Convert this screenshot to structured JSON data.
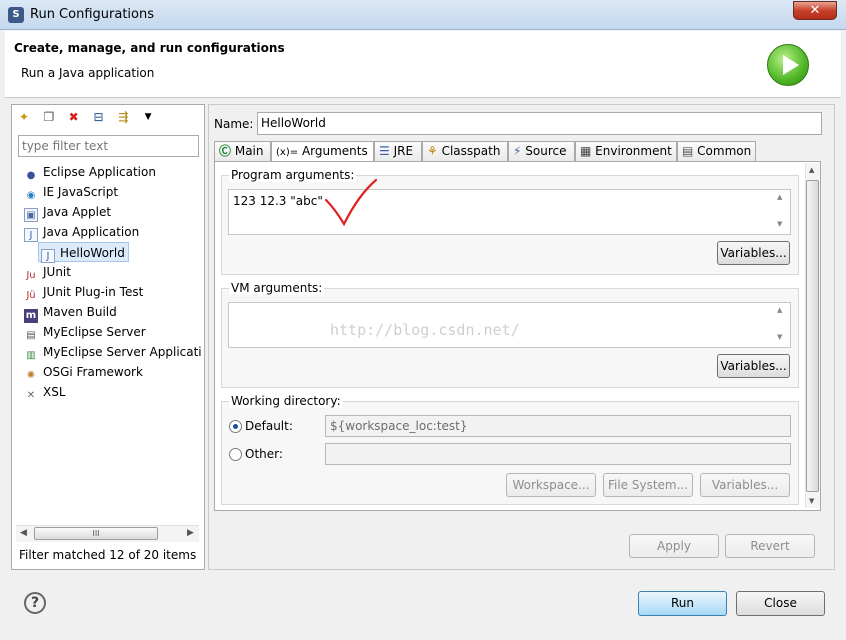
{
  "window": {
    "title": "Run Configurations",
    "close_glyph": "✕"
  },
  "banner": {
    "title": "Create, manage, and run configurations",
    "subtitle": "Run a Java application",
    "icon": "run-large-icon"
  },
  "left": {
    "filter_placeholder": "type filter text",
    "tree": [
      {
        "label": "Eclipse Application",
        "icon": "eclipse-icon"
      },
      {
        "label": "IE JavaScript",
        "icon": "ie-icon"
      },
      {
        "label": "Java Applet",
        "icon": "applet-icon"
      },
      {
        "label": "Java Application",
        "icon": "java-app-icon"
      },
      {
        "label": "HelloWorld",
        "icon": "java-file-icon",
        "selected": true
      },
      {
        "label": "JUnit",
        "icon": "junit-icon"
      },
      {
        "label": "JUnit Plug-in Test",
        "icon": "junit-plugin-icon"
      },
      {
        "label": "Maven Build",
        "icon": "maven-icon"
      },
      {
        "label": "MyEclipse Server",
        "icon": "server-icon"
      },
      {
        "label": "MyEclipse Server Applicati",
        "icon": "server-app-icon"
      },
      {
        "label": "OSGi Framework",
        "icon": "osgi-icon"
      },
      {
        "label": "XSL",
        "icon": "xsl-icon"
      }
    ],
    "status": "Filter matched 12 of 20 items",
    "scroll_label": "III"
  },
  "right": {
    "name_label": "Name:",
    "name_value": "HelloWorld",
    "tabs": [
      {
        "label": "Main",
        "icon": "main-icon"
      },
      {
        "label": "Arguments",
        "icon": "arguments-icon",
        "active": true
      },
      {
        "label": "JRE",
        "icon": "jre-icon"
      },
      {
        "label": "Classpath",
        "icon": "classpath-icon"
      },
      {
        "label": "Source",
        "icon": "source-icon"
      },
      {
        "label": "Environment",
        "icon": "environment-icon"
      },
      {
        "label": "Common",
        "icon": "common-icon"
      }
    ],
    "program_args_label": "Program arguments:",
    "program_args_value": "123 12.3 \"abc\"",
    "vm_args_label": "VM arguments:",
    "vm_args_value": "",
    "variables_label": "Variables...",
    "working_dir_label": "Working directory:",
    "default_label": "Default:",
    "default_value": "${workspace_loc:test}",
    "other_label": "Other:",
    "workspace_btn": "Workspace...",
    "filesystem_btn": "File System...",
    "variables_btn": "Variables...",
    "apply_btn": "Apply",
    "revert_btn": "Revert",
    "watermark": "http://blog.csdn.net/"
  },
  "footer": {
    "run_btn": "Run",
    "close_btn": "Close",
    "help": "?"
  },
  "colors": {
    "accent": "#3c7fb1",
    "check_mark": "#e02020"
  }
}
